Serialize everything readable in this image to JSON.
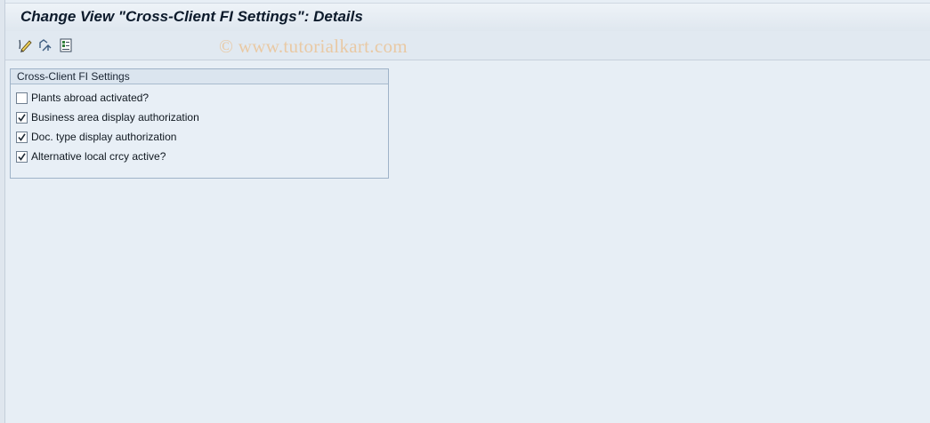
{
  "header": {
    "title": "Change View \"Cross-Client FI Settings\": Details"
  },
  "toolbar": {
    "buttons": [
      {
        "icon": "display-change-icon"
      },
      {
        "icon": "other-entry-icon"
      },
      {
        "icon": "select-list-icon"
      }
    ],
    "watermark": "© www.tutorialkart.com"
  },
  "group": {
    "title": "Cross-Client FI Settings",
    "items": [
      {
        "label": "Plants abroad activated?",
        "checked": false
      },
      {
        "label": "Business area display authorization",
        "checked": true
      },
      {
        "label": "Doc. type display authorization",
        "checked": true
      },
      {
        "label": "Alternative local crcy active?",
        "checked": true
      }
    ]
  }
}
